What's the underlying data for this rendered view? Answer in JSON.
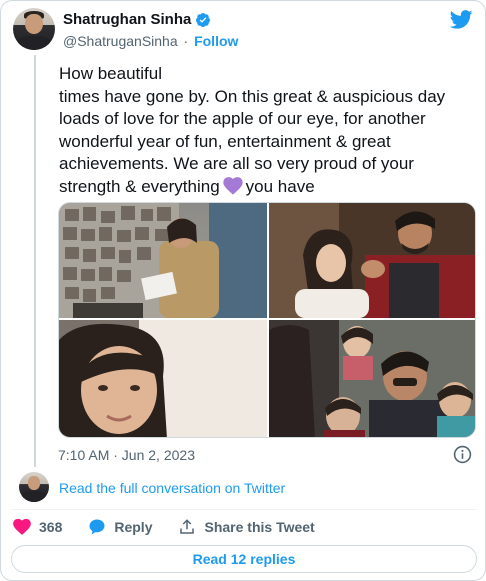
{
  "author": {
    "display_name": "Shatrughan Sinha",
    "handle": "@ShatruganSinha",
    "separator": "·",
    "follow_label": "Follow",
    "verified_color": "#1d9bf0"
  },
  "tweet": {
    "text_line1": "How beautiful",
    "text_body": "times have gone by. On this great & auspicious day loads of love for the apple of our eye, for another wonderful year of fun, entertainment & great achievements. We are all so very proud of your strength & everything",
    "text_tail": "you have",
    "emoji": "purple-heart",
    "emoji_color": "#a47ad6",
    "timestamp": "7:10 AM · Jun 2, 2023"
  },
  "media": {
    "photos": [
      {
        "name": "photo-police-uniform"
      },
      {
        "name": "photo-father-daughter"
      },
      {
        "name": "photo-child-portrait"
      },
      {
        "name": "photo-family-vintage"
      }
    ]
  },
  "conversation": {
    "link_label": "Read the full conversation on Twitter"
  },
  "actions": {
    "like_count": "368",
    "reply_label": "Reply",
    "share_label": "Share this Tweet"
  },
  "footer": {
    "read_replies_label": "Read 12 replies"
  },
  "colors": {
    "accent": "#1d9bf0",
    "like": "#f91880",
    "muted": "#536471",
    "border": "#cfd9de"
  },
  "icons": [
    "verified-icon",
    "twitter-bird-icon",
    "info-icon",
    "heart-icon",
    "reply-bubble-icon",
    "share-icon"
  ]
}
